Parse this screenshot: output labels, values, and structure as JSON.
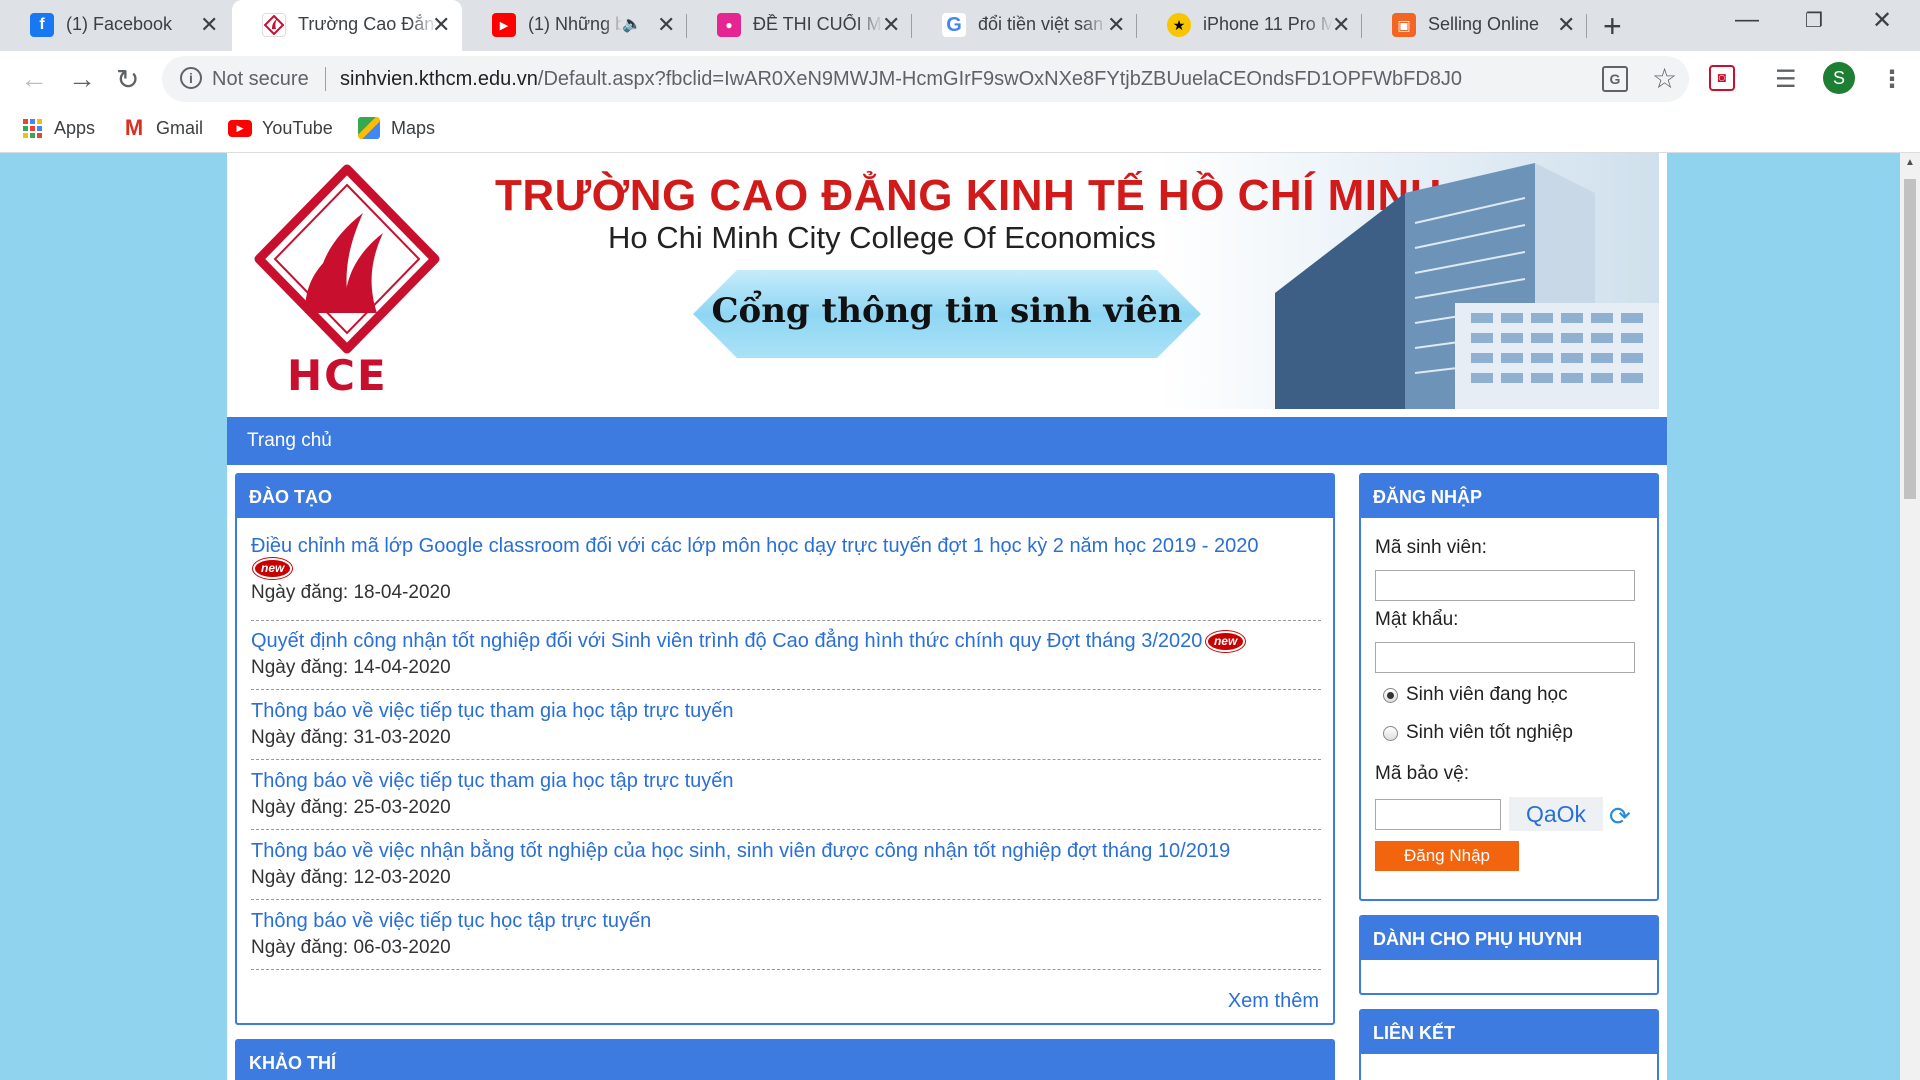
{
  "browser": {
    "tabs": [
      {
        "title": "(1) Facebook",
        "icon": "facebook-icon",
        "color": "#1877f2",
        "glyph": "f"
      },
      {
        "title": "Trường Cao Đẳn",
        "icon": "hce-logo-icon",
        "color": "#ffffff",
        "glyph": ""
      },
      {
        "title": "(1) Những b",
        "icon": "youtube-icon",
        "color": "#ff0000",
        "glyph": "▶"
      },
      {
        "title": "ĐỀ THI CUỐI MÔ",
        "icon": "classroom-icon",
        "color": "#e52592",
        "glyph": "●"
      },
      {
        "title": "đổi tiền việt san",
        "icon": "google-icon",
        "color": "#ffffff",
        "glyph": "G"
      },
      {
        "title": "iPhone 11 Pro M",
        "icon": "runner-icon",
        "color": "#f7c600",
        "glyph": "★"
      },
      {
        "title": "Selling Online",
        "icon": "store-icon",
        "color": "#f26522",
        "glyph": "▣"
      }
    ],
    "not_secure": "Not secure",
    "url_host": "sinhvien.kthcm.edu.vn",
    "url_path": "/Default.aspx?fbclid=IwAR0XeN9MWJM-HcmGIrF9swOxNXe8FYtjbZBUuelaCEOndsFD1OPFWbFD8J0",
    "profile_initial": "S",
    "bookmarks": [
      {
        "label": "Apps",
        "icon": "apps-grid-icon"
      },
      {
        "label": "Gmail",
        "icon": "gmail-icon"
      },
      {
        "label": "YouTube",
        "icon": "youtube-icon"
      },
      {
        "label": "Maps",
        "icon": "maps-icon"
      }
    ]
  },
  "site": {
    "banner": {
      "title_vn": "TRƯỜNG CAO ĐẲNG KINH TẾ HỒ CHÍ MINH",
      "title_en": "Ho Chi Minh City College Of Economics",
      "portal": "Cổng thông tin sinh viên",
      "logo_text": "HCE"
    },
    "nav": {
      "home": "Trang chủ"
    },
    "training": {
      "heading": "ĐÀO TẠO",
      "badge_text": "new",
      "items": [
        {
          "title": "Điều chỉnh mã lớp Google classroom đối với các lớp môn học dạy trực tuyến đợt 1 học kỳ 2 năm học 2019 - 2020",
          "date": "Ngày đăng: 18-04-2020",
          "new": true
        },
        {
          "title": "Quyết định công nhận tốt nghiệp đối với Sinh viên trình độ Cao đẳng hình thức chính quy Đợt tháng 3/2020",
          "date": "Ngày đăng: 14-04-2020",
          "new": true
        },
        {
          "title": "Thông báo về việc tiếp tục tham gia học tập trực tuyến",
          "date": "Ngày đăng: 31-03-2020",
          "new": false
        },
        {
          "title": "Thông báo về việc tiếp tục tham gia học tập trực tuyến",
          "date": "Ngày đăng: 25-03-2020",
          "new": false
        },
        {
          "title": "Thông báo về việc nhận bằng tốt nghiệp của học sinh, sinh viên được công nhận tốt nghiệp đợt tháng 10/2019",
          "date": "Ngày đăng: 12-03-2020",
          "new": false
        },
        {
          "title": "Thông báo về việc tiếp tục học tập trực tuyến",
          "date": "Ngày đăng: 06-03-2020",
          "new": false
        }
      ],
      "more": "Xem thêm"
    },
    "exams": {
      "heading": "KHẢO THÍ"
    },
    "login": {
      "heading": "ĐĂNG NHẬP",
      "student_id_label": "Mã sinh viên:",
      "password_label": "Mật khẩu:",
      "radio_current": "Sinh viên đang học",
      "radio_graduated": "Sinh viên tốt nghiệp",
      "captcha_label": "Mã bảo vệ:",
      "captcha_code": "QaOk",
      "submit": "Đăng Nhập"
    },
    "parents": {
      "heading": "DÀNH CHO PHỤ HUYNH"
    },
    "links": {
      "heading": "LIÊN KẾT"
    }
  }
}
